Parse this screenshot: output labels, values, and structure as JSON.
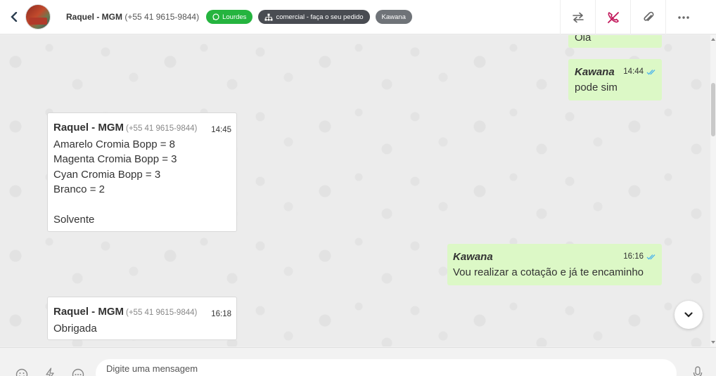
{
  "header": {
    "contact_name": "Raquel - MGM",
    "contact_phone": "(+55 41 9615-9844)",
    "tags": [
      {
        "label": "Lourdes",
        "icon": "whatsapp-icon",
        "color": "#25b43f"
      },
      {
        "label": "comercial - faça o seu pedido",
        "icon": "org-chart-icon",
        "color": "#494c52"
      },
      {
        "label": "Kawana",
        "icon": "",
        "color": "#6f7378"
      }
    ],
    "actions": [
      "transfer-arrows-icon",
      "end-call-phone-icon",
      "paperclip-icon",
      "more-dots-icon"
    ]
  },
  "messages": [
    {
      "direction": "out",
      "text": "Olá"
    },
    {
      "direction": "out",
      "agent": "Kawana",
      "time": "14:44",
      "text": "pode sim",
      "status": "read"
    },
    {
      "direction": "in",
      "sender": "Raquel - MGM",
      "phone": "(+55 41 9615-9844)",
      "time": "14:45",
      "text": "Amarelo Cromia Bopp = 8\nMagenta Cromia Bopp = 3\nCyan Cromia Bopp = 3\nBranco = 2\n\nSolvente"
    },
    {
      "direction": "out",
      "agent": "Kawana",
      "time": "16:16",
      "text": "Vou realizar a cotação e já te encaminho",
      "status": "read"
    },
    {
      "direction": "in",
      "sender": "Raquel - MGM",
      "phone": "(+55 41 9615-9844)",
      "time": "16:18",
      "text": "Obrigada"
    }
  ],
  "composer": {
    "placeholder": "Digite uma mensagem",
    "icons": [
      "emoji-icon",
      "lightning-icon",
      "more-options-icon",
      "microphone-icon"
    ]
  },
  "colors": {
    "accent_green": "#25b43f",
    "outgoing_bubble": "#dcf8c6",
    "read_check": "#4fb6ec",
    "end_call": "#c2185b"
  }
}
